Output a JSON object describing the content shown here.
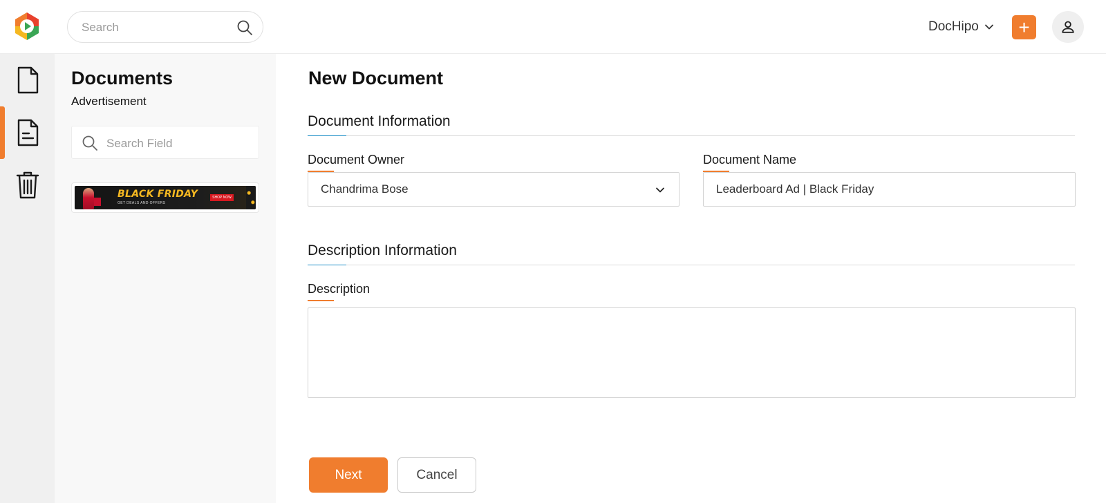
{
  "header": {
    "search_placeholder": "Search",
    "workspace_label": "DocHipo",
    "add_label": "+",
    "accent_color": "#f07d2e"
  },
  "rail": {
    "items": [
      {
        "icon": "document-icon",
        "active": false
      },
      {
        "icon": "document-lines-icon",
        "active": true
      },
      {
        "icon": "trash-icon",
        "active": false
      }
    ]
  },
  "panel": {
    "title": "Documents",
    "subtitle": "Advertisement",
    "search_placeholder": "Search Field",
    "thumbnail": {
      "headline": "BLACK FRIDAY",
      "tagline": "GET DEALS AND OFFERS",
      "cta": "SHOP NOW"
    }
  },
  "main": {
    "title": "New Document",
    "doc_info": {
      "section_title": "Document Information",
      "owner_label": "Document Owner",
      "owner_value": "Chandrima Bose",
      "name_label": "Document Name",
      "name_value": "Leaderboard Ad | Black Friday"
    },
    "desc_info": {
      "section_title": "Description Information",
      "description_label": "Description",
      "description_value": ""
    },
    "actions": {
      "next_label": "Next",
      "cancel_label": "Cancel"
    }
  }
}
